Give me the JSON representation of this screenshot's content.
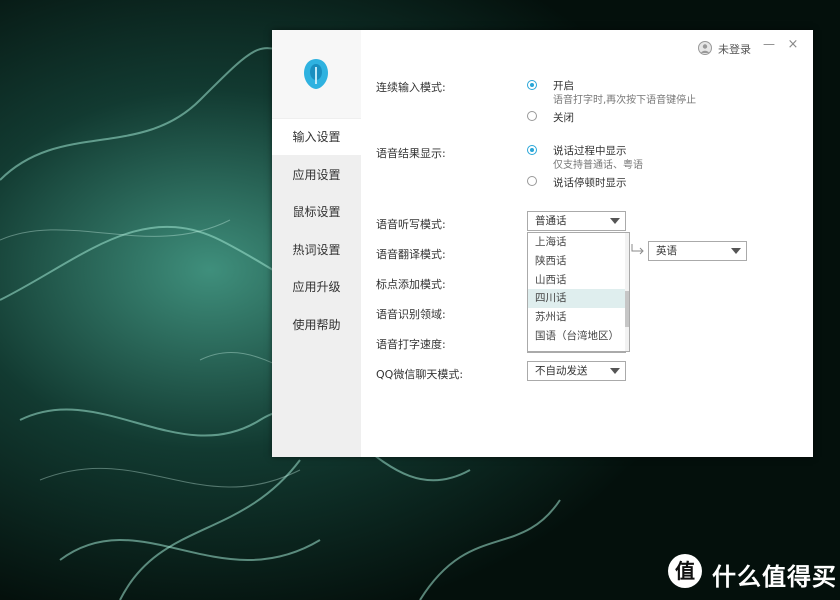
{
  "user": {
    "login_label": "未登录"
  },
  "window_controls": {
    "minimize": "—",
    "close": "×"
  },
  "nav": {
    "items": [
      {
        "label": "输入设置",
        "active": true
      },
      {
        "label": "应用设置",
        "active": false
      },
      {
        "label": "鼠标设置",
        "active": false
      },
      {
        "label": "热词设置",
        "active": false
      },
      {
        "label": "应用升级",
        "active": false
      },
      {
        "label": "使用帮助",
        "active": false
      }
    ]
  },
  "settings": {
    "continuous_input": {
      "label": "连续输入模式:",
      "options": [
        {
          "text": "开启",
          "sub": "语音打字时,再次按下语音键停止",
          "selected": true
        },
        {
          "text": "关闭",
          "sub": "",
          "selected": false
        }
      ]
    },
    "result_display": {
      "label": "语音结果显示:",
      "options": [
        {
          "text": "说话过程中显示",
          "sub": "仅支持普通话、粤语",
          "selected": true
        },
        {
          "text": "说话停顿时显示",
          "sub": "",
          "selected": false
        }
      ]
    },
    "dictation_mode": {
      "label": "语音听写模式:",
      "value": "普通话"
    },
    "translation_mode": {
      "label": "语音翻译模式:",
      "target": "英语"
    },
    "punctuation_mode": {
      "label": "标点添加模式:"
    },
    "recognition_domain": {
      "label": "语音识别领域:"
    },
    "typing_speed": {
      "label": "语音打字速度:"
    },
    "qq_wechat_mode": {
      "label": "QQ微信聊天模式:",
      "value": "不自动发送"
    }
  },
  "dropdown": {
    "items": [
      "上海话",
      "陕西话",
      "山西话",
      "四川话",
      "苏州话",
      "国语（台湾地区）"
    ],
    "hovered_index": 3
  },
  "watermark": {
    "badge": "值",
    "text": "什么值得买"
  },
  "colors": {
    "accent": "#29a6d8",
    "logo": "#2fb2e0",
    "sidebar": "#efefef"
  }
}
